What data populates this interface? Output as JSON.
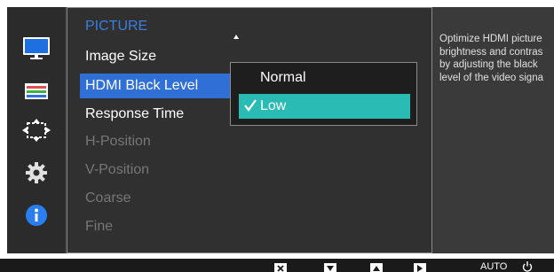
{
  "rail": {
    "icons": [
      "monitor-icon",
      "color-settings-icon",
      "size-position-icon",
      "gear-icon",
      "info-icon"
    ]
  },
  "menu": {
    "title": "PICTURE",
    "items": [
      {
        "label": "Image Size",
        "state": "normal"
      },
      {
        "label": "HDMI Black Level",
        "state": "selected"
      },
      {
        "label": "Response Time",
        "state": "normal"
      },
      {
        "label": "H-Position",
        "state": "disabled"
      },
      {
        "label": "V-Position",
        "state": "disabled"
      },
      {
        "label": "Coarse",
        "state": "disabled"
      },
      {
        "label": "Fine",
        "state": "disabled"
      }
    ]
  },
  "submenu": {
    "options": [
      {
        "label": "Normal",
        "selected": false
      },
      {
        "label": "Low",
        "selected": true
      }
    ]
  },
  "description": "Optimize HDMI picture brightness and contrast by adjusting the black level of the video signal.",
  "description_visible": "Optimize HDMI picture\nbrightness and contras\nby adjusting the black\nlevel of the video signa",
  "buttons": {
    "close_icon": "close-icon",
    "down_icon": "down-arrow-icon",
    "up_icon": "up-arrow-icon",
    "enter_icon": "enter-arrow-icon",
    "auto_label": "AUTO",
    "power_icon": "power-icon"
  },
  "colors": {
    "accent_blue": "#2f6fd6",
    "title_blue": "#3b7de0",
    "teal": "#2bbbb5",
    "osd_bg": "#3a3a3a"
  }
}
